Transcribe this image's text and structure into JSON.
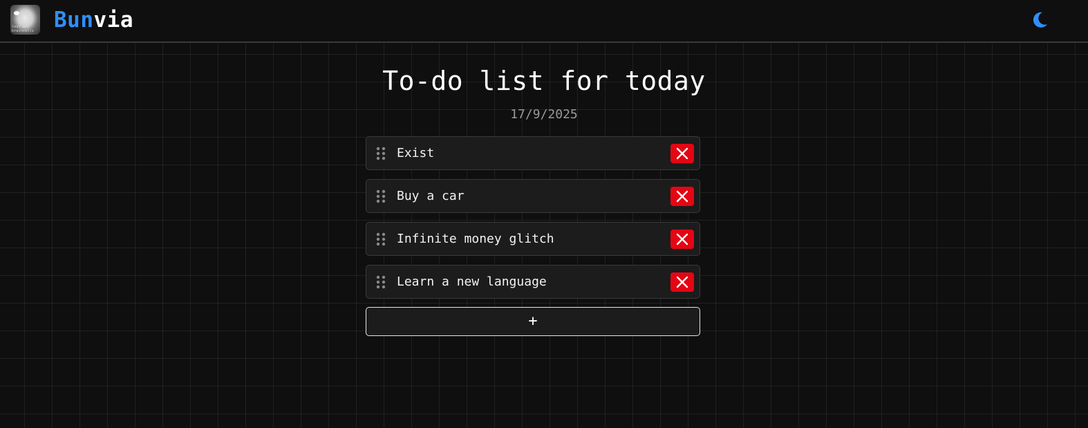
{
  "header": {
    "brand_part1": "Bun",
    "brand_part2": "via",
    "logo_caption": "lost all braincells",
    "theme_icon": "moon-icon",
    "accent_color": "#2f8fff"
  },
  "main": {
    "title": "To-do list for today",
    "date": "17/9/2025",
    "items": [
      {
        "label": "Exist"
      },
      {
        "label": "Buy a car"
      },
      {
        "label": "Infinite money glitch"
      },
      {
        "label": "Learn a new language"
      }
    ],
    "add_label": "+",
    "delete_color": "#e40613"
  }
}
